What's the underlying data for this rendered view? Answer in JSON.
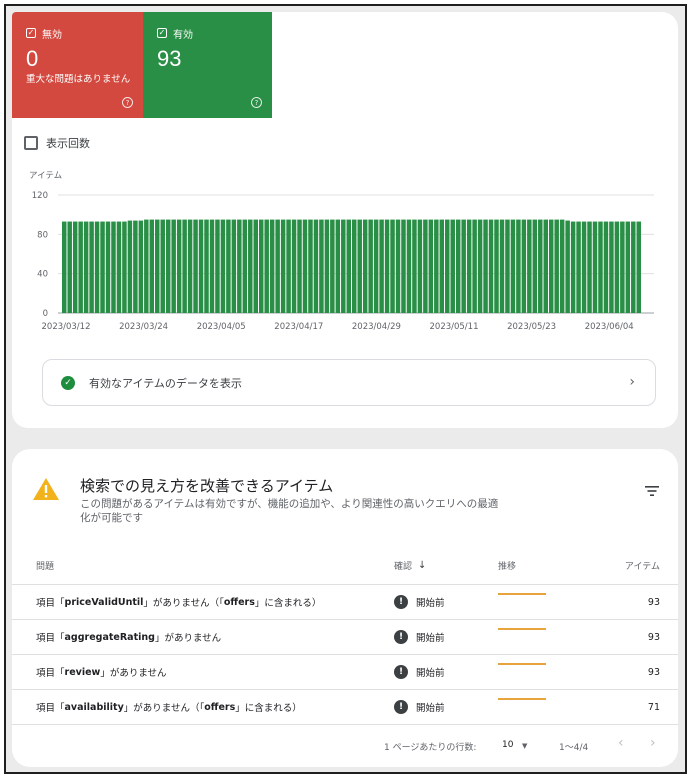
{
  "summary": {
    "invalid": {
      "label": "無効",
      "count": "0",
      "description": "重大な問題はありません",
      "color": "#d3493f",
      "help_icon": "help-circle"
    },
    "valid": {
      "label": "有効",
      "count": "93",
      "color": "#2a8f46",
      "help_icon": "help-circle"
    }
  },
  "impressions_label": "表示回数",
  "chart_data": {
    "type": "bar",
    "ylabel": "アイテム",
    "ylim": [
      0,
      120
    ],
    "yticks": [
      "120",
      "80",
      "40",
      "0"
    ],
    "xticks": [
      "2023/03/12",
      "2023/03/24",
      "2023/04/05",
      "2023/04/17",
      "2023/04/29",
      "2023/05/11",
      "2023/05/23",
      "2023/06/04"
    ],
    "bar_color": "#2a8f46",
    "grid": true,
    "values": [
      93,
      93,
      93,
      93,
      93,
      93,
      93,
      93,
      93,
      93,
      93,
      93,
      94,
      94,
      94,
      95,
      95,
      95,
      95,
      95,
      95,
      95,
      95,
      95,
      95,
      95,
      95,
      95,
      95,
      95,
      95,
      95,
      95,
      95,
      95,
      95,
      95,
      95,
      95,
      95,
      95,
      95,
      95,
      95,
      95,
      95,
      95,
      95,
      95,
      95,
      95,
      95,
      95,
      95,
      95,
      95,
      95,
      95,
      95,
      95,
      95,
      95,
      95,
      95,
      95,
      95,
      95,
      95,
      95,
      95,
      95,
      95,
      95,
      95,
      95,
      95,
      95,
      95,
      95,
      95,
      95,
      95,
      95,
      95,
      95,
      95,
      95,
      95,
      95,
      95,
      95,
      95,
      94,
      93,
      93,
      93,
      93,
      93,
      93,
      93,
      93,
      93,
      93,
      93,
      93,
      93
    ]
  },
  "view_valid_button": {
    "label": "有効なアイテムのデータを表示",
    "icon": "check-circle",
    "chevron": "›"
  },
  "enhancements": {
    "title": "検索での見え方を改善できるアイテム",
    "description": "この問題があるアイテムは有効ですが、機能の追加や、より関連性の高いクエリへの最適化が可能です",
    "icon": "warning-triangle",
    "filter_icon": "filter",
    "columns": {
      "issue": "問題",
      "status": "確認",
      "sort": "↓",
      "trend": "推移",
      "items": "アイテム"
    },
    "trend_color": "#e8a33c",
    "rows": [
      {
        "issue_prefix": "項目「",
        "field": "priceValidUntil",
        "issue_suffix": "」がありません（「",
        "container": "offers",
        "issue_end": "」に含まれる）",
        "status": "開始前",
        "items": "93"
      },
      {
        "issue_prefix": "項目「",
        "field": "aggregateRating",
        "issue_suffix": "」がありません",
        "container": "",
        "issue_end": "",
        "status": "開始前",
        "items": "93"
      },
      {
        "issue_prefix": "項目「",
        "field": "review",
        "issue_suffix": "」がありません",
        "container": "",
        "issue_end": "",
        "status": "開始前",
        "items": "93"
      },
      {
        "issue_prefix": "項目「",
        "field": "availability",
        "issue_suffix": "」がありません（「",
        "container": "offers",
        "issue_end": "」に含まれる）",
        "status": "開始前",
        "items": "71"
      }
    ],
    "pager": {
      "rows_per_page_label": "1 ページあたりの行数:",
      "rows_per_page": "10",
      "range": "1〜4/4",
      "prev": "‹",
      "next": "›"
    }
  }
}
